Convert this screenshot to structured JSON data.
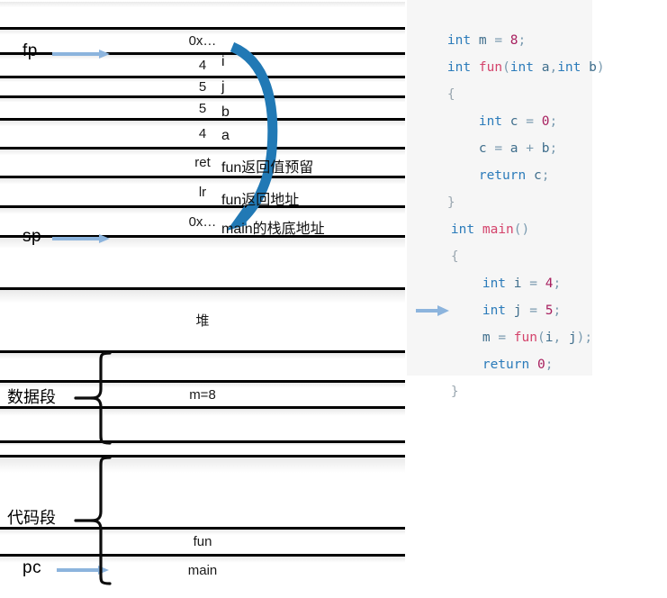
{
  "diagram": {
    "title": "Stack frame layout for fun(i, j) called from main",
    "accent_blue": "#1f7bbf",
    "arrow_blue": "#8cb4dd",
    "stack_rows": [
      {
        "label": "",
        "annotation": ""
      },
      {
        "label": "0x…",
        "annotation": ""
      },
      {
        "label": "4",
        "annotation": "i"
      },
      {
        "label": "5",
        "annotation": "j"
      },
      {
        "label": "5",
        "annotation": "b"
      },
      {
        "label": "4",
        "annotation": "a"
      },
      {
        "label": "ret",
        "annotation": "fun返回值预留"
      },
      {
        "label": "lr",
        "annotation": "fun返回地址"
      },
      {
        "label": "0x…",
        "annotation": "main的栈底地址"
      },
      {
        "label": "",
        "annotation": ""
      },
      {
        "label": "堆",
        "annotation": ""
      },
      {
        "label": "",
        "annotation": ""
      },
      {
        "label": "m=8",
        "annotation": ""
      },
      {
        "label": "",
        "annotation": ""
      },
      {
        "label": "",
        "annotation": ""
      },
      {
        "label": "",
        "annotation": ""
      },
      {
        "label": "fun",
        "annotation": ""
      },
      {
        "label": "main",
        "annotation": ""
      }
    ],
    "pointers": [
      {
        "name": "fp",
        "label": "fp"
      },
      {
        "name": "sp",
        "label": "sp"
      },
      {
        "name": "pc",
        "label": "pc"
      }
    ],
    "segments": [
      {
        "name": "data-segment",
        "label": "数据段"
      },
      {
        "name": "code-segment",
        "label": "代码段"
      }
    ],
    "annotations": [
      "i",
      "j",
      "b",
      "a",
      "fun返回值预留",
      "fun返回地址",
      "main的栈底地址"
    ]
  },
  "code": {
    "background": "#f6f6f6",
    "current_line_marker": "arrow-right-icon",
    "current_line_index": 12,
    "lines": [
      "int m = 8;",
      "int fun(int a,int b)",
      "{",
      "    int c = 0;",
      "    c = a + b;",
      "    return c;",
      "}",
      " int main()",
      " {",
      "     int i = 4;",
      "     int j = 5;",
      "",
      "  m = fun(i, j);",
      "     return 0;",
      " }"
    ]
  }
}
